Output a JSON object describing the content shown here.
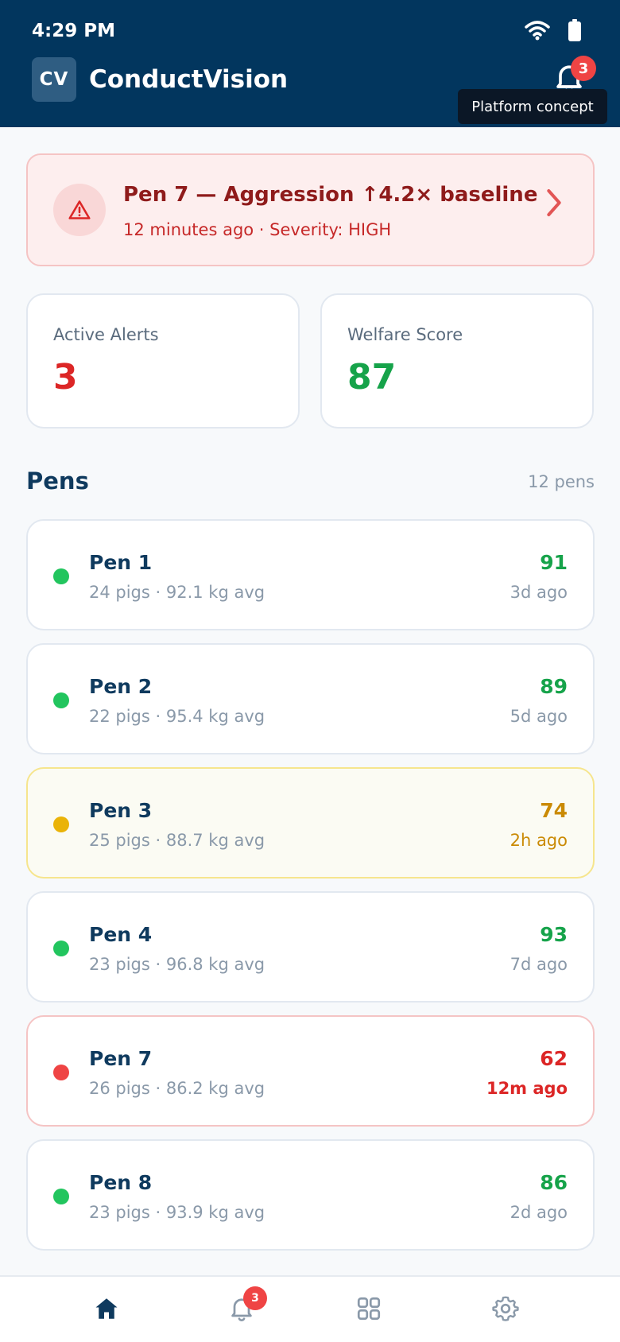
{
  "status_bar": {
    "time": "4:29 PM"
  },
  "header": {
    "logo_text": "CV",
    "app_name": "ConductVision",
    "notification_count": "3",
    "tooltip": "Platform concept"
  },
  "alert_banner": {
    "title": "Pen 7 — Aggression ↑4.2× baseline",
    "subtitle": "12 minutes ago · Severity: HIGH"
  },
  "stats": [
    {
      "label": "Active Alerts",
      "value": "3",
      "color": "#dc2626"
    },
    {
      "label": "Welfare Score",
      "value": "87",
      "color": "#16a34a"
    }
  ],
  "pens_section": {
    "title": "Pens",
    "count": "12 pens"
  },
  "pens": [
    {
      "name": "Pen 1",
      "meta": "24 pigs · 92.1 kg avg",
      "score": "91",
      "time": "3d ago",
      "status": "good"
    },
    {
      "name": "Pen 2",
      "meta": "22 pigs · 95.4 kg avg",
      "score": "89",
      "time": "5d ago",
      "status": "good"
    },
    {
      "name": "Pen 3",
      "meta": "25 pigs · 88.7 kg avg",
      "score": "74",
      "time": "2h ago",
      "status": "warn"
    },
    {
      "name": "Pen 4",
      "meta": "23 pigs · 96.8 kg avg",
      "score": "93",
      "time": "7d ago",
      "status": "good"
    },
    {
      "name": "Pen 7",
      "meta": "26 pigs · 86.2 kg avg",
      "score": "62",
      "time": "12m ago",
      "status": "alert"
    },
    {
      "name": "Pen 8",
      "meta": "23 pigs · 93.9 kg avg",
      "score": "86",
      "time": "2d ago",
      "status": "good"
    }
  ],
  "status_colors": {
    "good": "#22c55e",
    "warn": "#eab308",
    "alert": "#ef4444"
  },
  "bottom_nav": {
    "alerts_badge": "3",
    "items": [
      {
        "icon": "home-icon",
        "active": true
      },
      {
        "icon": "bell-icon"
      },
      {
        "icon": "grid-icon"
      },
      {
        "icon": "gear-icon"
      }
    ]
  }
}
